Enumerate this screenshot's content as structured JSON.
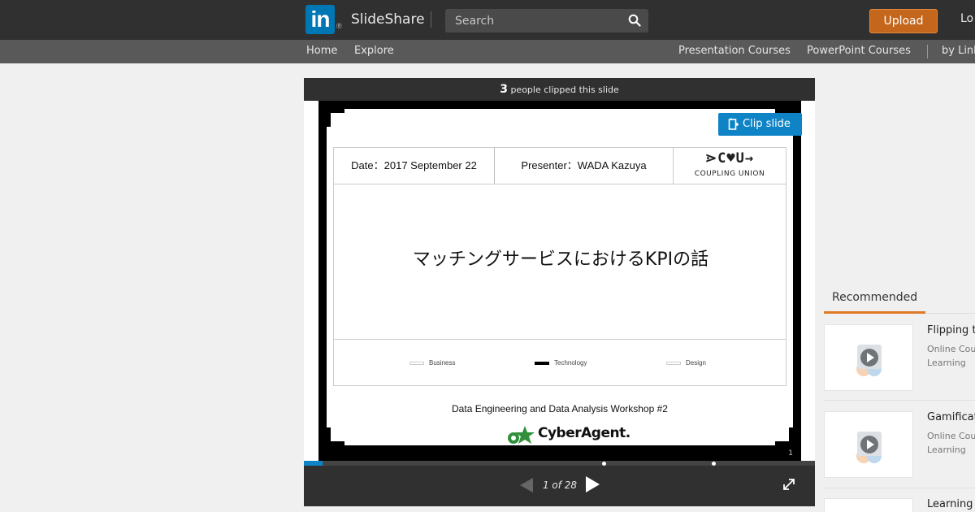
{
  "header": {
    "logo_text": "in",
    "logo_reg": "®",
    "brand": "SlideShare",
    "search_placeholder": "Search",
    "upload_label": "Upload",
    "login_label": "Lo"
  },
  "subnav": {
    "home": "Home",
    "explore": "Explore",
    "presentation_courses": "Presentation Courses",
    "powerpoint_courses": "PowerPoint Courses",
    "by_linkedin": "by Link"
  },
  "player": {
    "clip_count": "3",
    "clip_text": "people clipped this slide",
    "clip_button": "Clip slide",
    "page_indicator": "1 of 28",
    "progress_fraction": 0.036,
    "marker_fractions": [
      0.588,
      0.802
    ]
  },
  "slide": {
    "date": "Date：2017 September 22",
    "presenter": "Presenter：WADA Kazuya",
    "logo_main": "⋗C♥U→",
    "logo_sub": "COUPLING UNION",
    "title": "マッチングサービスにおけるKPIの話",
    "legend": [
      "Business",
      "Technology",
      "Design"
    ],
    "workshop": "Data Engineering and Data Analysis Workshop #2",
    "sponsor": "CyberAgent.",
    "slide_number": "1"
  },
  "recommended": {
    "tab_label": "Recommended",
    "items": [
      {
        "title": "Flipping t",
        "sub1": "Online Cou",
        "sub2": "Learning"
      },
      {
        "title": "Gamificat",
        "sub1": "Online Cou",
        "sub2": "Learning"
      },
      {
        "title": "Learning",
        "sub1": "",
        "sub2": ""
      }
    ]
  },
  "colors": {
    "topbar": "#303030",
    "subnav": "#595959",
    "upload": "#c4671d",
    "clip_button": "#0e83c6",
    "recommended_accent": "#e07a24"
  }
}
